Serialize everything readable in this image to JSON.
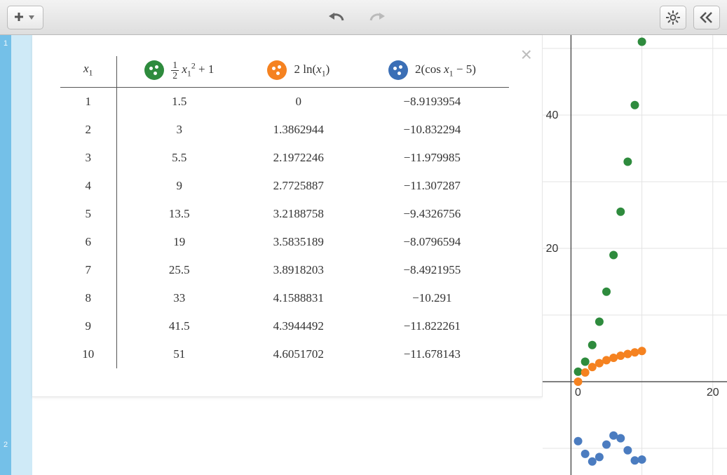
{
  "gutter": {
    "row1": "1",
    "row2": "2"
  },
  "table": {
    "x_label_base": "x",
    "x_label_sub": "1",
    "headers": {
      "col1_html": "<span class='frac'><span class='n'>1</span><span class='d'>2</span></span> <i>x</i><sub>1</sub><sup>2</sup> + 1",
      "col2_html": "2 ln(<i>x</i><sub>1</sub>)",
      "col3_html": "2(cos <i>x</i><sub>1</sub> − 5)"
    },
    "rows": [
      {
        "x": "1",
        "a": "1.5",
        "b": "0",
        "c": "−8.9193954"
      },
      {
        "x": "2",
        "a": "3",
        "b": "1.3862944",
        "c": "−10.832294"
      },
      {
        "x": "3",
        "a": "5.5",
        "b": "2.1972246",
        "c": "−11.979985"
      },
      {
        "x": "4",
        "a": "9",
        "b": "2.7725887",
        "c": "−11.307287"
      },
      {
        "x": "5",
        "a": "13.5",
        "b": "3.2188758",
        "c": "−9.4326756"
      },
      {
        "x": "6",
        "a": "19",
        "b": "3.5835189",
        "c": "−8.0796594"
      },
      {
        "x": "7",
        "a": "25.5",
        "b": "3.8918203",
        "c": "−8.4921955"
      },
      {
        "x": "8",
        "a": "33",
        "b": "4.1588831",
        "c": "−10.291"
      },
      {
        "x": "9",
        "a": "41.5",
        "b": "4.3944492",
        "c": "−11.822261"
      },
      {
        "x": "10",
        "a": "51",
        "b": "4.6051702",
        "c": "−11.678143"
      }
    ]
  },
  "axis_labels": {
    "y40": "40",
    "y20": "20",
    "origin": "0",
    "x20": "20"
  },
  "chart_data": {
    "type": "scatter",
    "xlabel": "",
    "ylabel": "",
    "xlim": [
      -4,
      22
    ],
    "ylim": [
      -14,
      52
    ],
    "series": [
      {
        "name": "½x² + 1",
        "color": "#2e8b3d",
        "x": [
          1,
          2,
          3,
          4,
          5,
          6,
          7,
          8,
          9,
          10
        ],
        "y": [
          1.5,
          3,
          5.5,
          9,
          13.5,
          19,
          25.5,
          33,
          41.5,
          51
        ]
      },
      {
        "name": "2 ln(x)",
        "color": "#f58220",
        "x": [
          1,
          2,
          3,
          4,
          5,
          6,
          7,
          8,
          9,
          10
        ],
        "y": [
          0,
          1.3862944,
          2.1972246,
          2.7725887,
          3.2188758,
          3.5835189,
          3.8918203,
          4.1588831,
          4.3944492,
          4.6051702
        ]
      },
      {
        "name": "2(cos x − 5)",
        "color": "#4b7cc0",
        "x": [
          1,
          2,
          3,
          4,
          5,
          6,
          7,
          8,
          9,
          10
        ],
        "y": [
          -8.9193954,
          -10.832294,
          -11.979985,
          -11.307287,
          -9.4326756,
          -8.0796594,
          -8.4921955,
          -10.291,
          -11.822261,
          -11.678143
        ]
      }
    ]
  }
}
